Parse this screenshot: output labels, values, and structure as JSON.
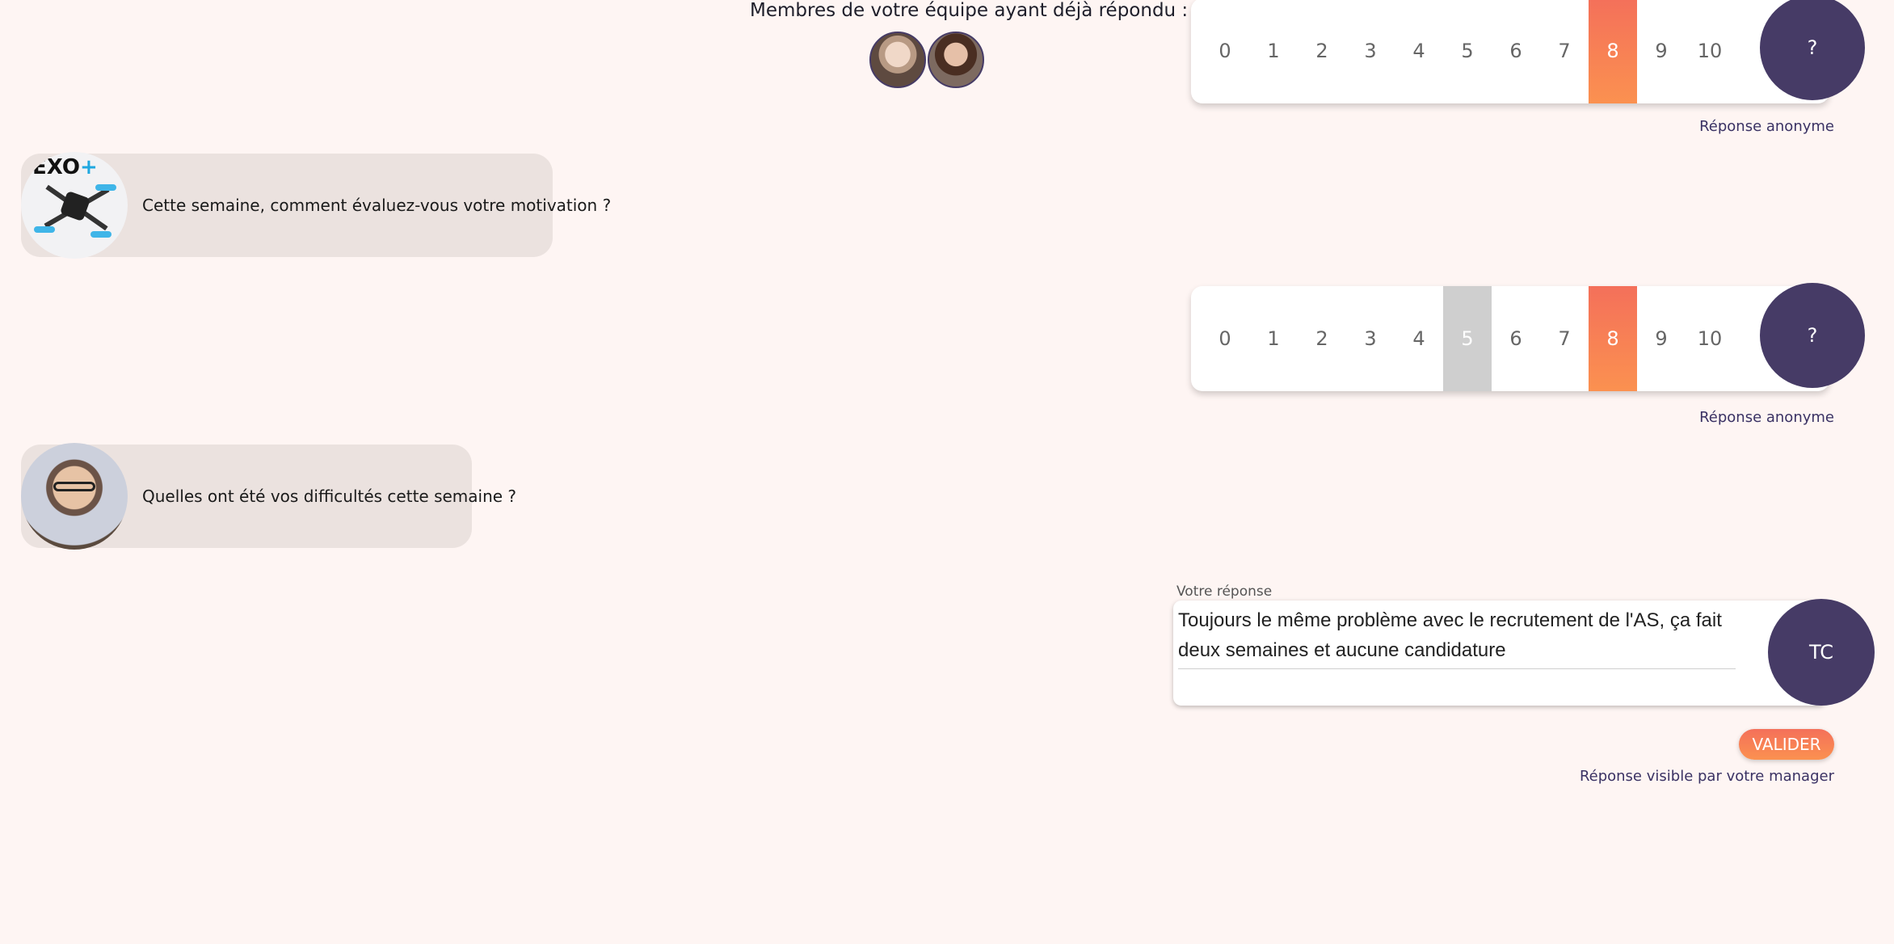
{
  "team": {
    "title": "Membres de votre équipe ayant déjà répondu :"
  },
  "scale_numbers": [
    "0",
    "1",
    "2",
    "3",
    "4",
    "5",
    "6",
    "7",
    "8",
    "9",
    "10"
  ],
  "scale1": {
    "selected": "8",
    "help_label": "?",
    "note": "Réponse anonyme"
  },
  "question1": {
    "text": "Cette semaine, comment évaluez-vous votre motivation ?",
    "avatar_logo_prefix": "EXO",
    "avatar_logo_suffix": "+"
  },
  "scale2": {
    "selected": "8",
    "average": "5",
    "help_label": "?",
    "note": "Réponse anonyme"
  },
  "question2": {
    "text": "Quelles ont été vos difficultés cette semaine ?"
  },
  "answer": {
    "label": "Votre réponse",
    "value": "Toujours le même problème avec le recrutement de l'AS, ça fait deux semaines et aucune candidature",
    "initials": "TC",
    "submit_label": "VALIDER",
    "note": "Réponse visible par votre manager"
  },
  "colors": {
    "accent": "#fb7e55",
    "primary": "#463b66",
    "background": "#fef5f3"
  }
}
